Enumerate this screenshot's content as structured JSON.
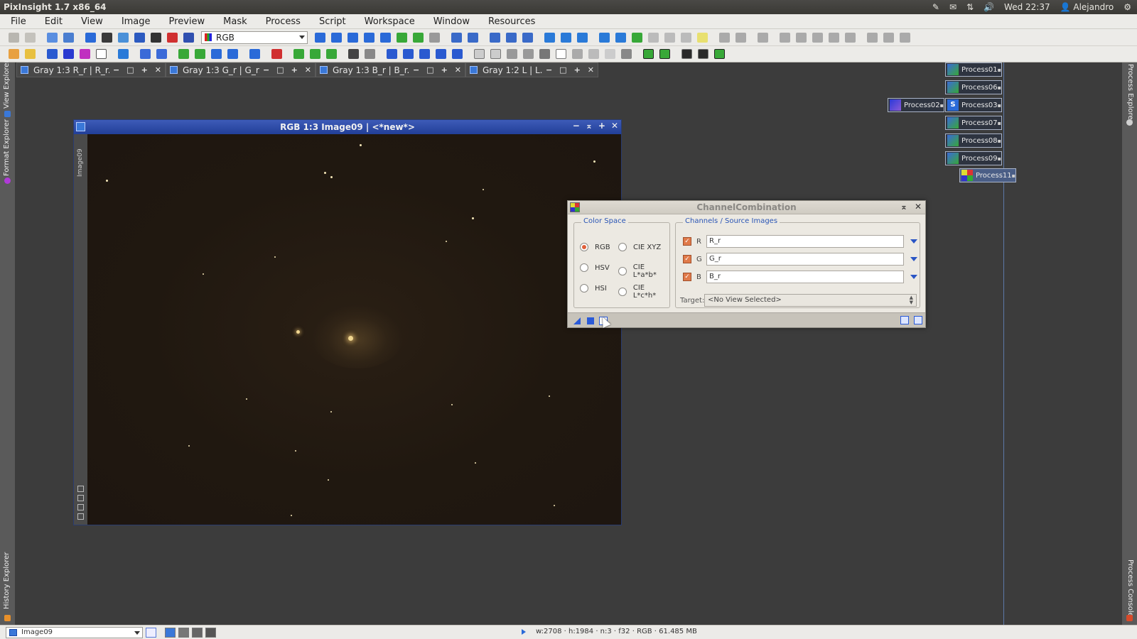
{
  "system_bar": {
    "app_title": "PixInsight 1.7 x86_64",
    "clock": "Wed 22:37",
    "user": "Alejandro"
  },
  "menu": {
    "items": [
      "File",
      "Edit",
      "View",
      "Image",
      "Preview",
      "Mask",
      "Process",
      "Script",
      "Workspace",
      "Window",
      "Resources"
    ]
  },
  "toolbar": {
    "colorspace_value": "RGB"
  },
  "docks": {
    "left": {
      "view_explorer": "View Explorer",
      "format_explorer": "Format Explorer",
      "history_explorer": "History Explorer"
    },
    "right": {
      "process_explorer": "Process Explorer",
      "process_console": "Process Console"
    }
  },
  "tabs": [
    {
      "label": "Gray 1:3 R_r | R_r..."
    },
    {
      "label": "Gray 1:3 G_r | G_r..."
    },
    {
      "label": "Gray 1:3 B_r | B_r..."
    },
    {
      "label": "Gray 1:2 L | L..."
    }
  ],
  "image_window": {
    "title": "RGB 1:3 Image09 | <*new*>",
    "side_label": "Image09"
  },
  "process_icons": [
    {
      "label": "Process01"
    },
    {
      "label": "Process06"
    },
    {
      "label": "Process02"
    },
    {
      "label": "Process03"
    },
    {
      "label": "Process07"
    },
    {
      "label": "Process08"
    },
    {
      "label": "Process09"
    },
    {
      "label": "Process11"
    }
  ],
  "channel_combination": {
    "title": "ChannelCombination",
    "color_space_title": "Color Space",
    "color_spaces": [
      "RGB",
      "CIE XYZ",
      "HSV",
      "CIE L*a*b*",
      "HSI",
      "CIE L*c*h*"
    ],
    "selected_color_space": "RGB",
    "channels_title": "Channels / Source Images",
    "channels": [
      {
        "label": "R",
        "value": "R_r"
      },
      {
        "label": "G",
        "value": "G_r"
      },
      {
        "label": "B",
        "value": "B_r"
      }
    ],
    "target_label": "Target:",
    "target_value": "<No View Selected>"
  },
  "status_bar": {
    "view_name": "Image09",
    "info": "w:2708 · h:1984 · n:3 · f32 · RGB · 61.485 MB"
  },
  "colors": {
    "accent": "#2a55b5",
    "window_title": "#223f98",
    "checkbox": "#e07a4a"
  }
}
